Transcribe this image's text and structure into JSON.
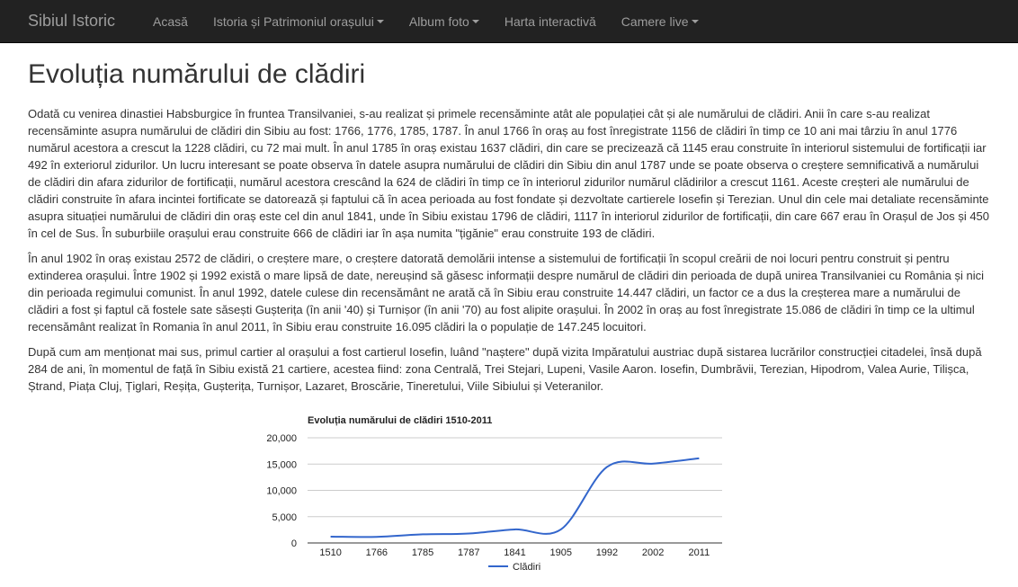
{
  "navbar": {
    "brand": "Sibiul Istoric",
    "items": [
      {
        "label": "Acasă",
        "dropdown": false
      },
      {
        "label": "Istoria și Patrimoniul orașului",
        "dropdown": true
      },
      {
        "label": "Album foto",
        "dropdown": true
      },
      {
        "label": "Harta interactivă",
        "dropdown": false
      },
      {
        "label": "Camere live",
        "dropdown": true
      }
    ]
  },
  "page": {
    "title": "Evoluția numărului de clădiri",
    "paragraphs": [
      "Odată cu venirea dinastiei Habsburgice în fruntea Transilvaniei, s-au realizat și primele recensăminte atât ale populației cât și ale numărului de clădiri. Anii în care s-au realizat recensăminte asupra numărului de clădiri din Sibiu au fost: 1766, 1776, 1785, 1787. În anul 1766 în oraș au fost înregistrate 1156 de clădiri în timp ce 10 ani mai târziu în anul 1776 numărul acestora a crescut la 1228 clădiri, cu 72 mai mult. În anul 1785 în oraș existau 1637 clădiri, din care se precizează că 1145 erau construite în interiorul sistemului de fortificații iar 492 în exteriorul zidurilor. Un lucru interesant se poate observa în datele asupra numărului de clădiri din Sibiu din anul 1787 unde se poate observa o creștere semnificativă a numărului de clădiri din afara zidurilor de fortificații, numărul acestora crescând la 624 de clădiri în timp ce în interiorul zidurilor numărul clădirilor a crescut 1161. Aceste creșteri ale numărului de clădiri construite în afara incintei fortificate se datorează și faptului că în acea perioada au fost fondate și dezvoltate cartierele Iosefin și Terezian. Unul din cele mai detaliate recensăminte asupra situației numărului de clădiri din oraș este cel din anul 1841, unde în Sibiu existau 1796 de clădiri, 1117 în interiorul zidurilor de fortificații, din care 667 erau în Orașul de Jos și 450 în cel de Sus. În suburbiile orașului erau construite 666 de clădiri iar în așa numita \"țigănie\" erau construite 193 de clădiri.",
      "În anul 1902 în oraș existau 2572 de clădiri, o creștere mare, o creștere datorată demolării intense a sistemului de fortificații în scopul creării de noi locuri pentru construit și pentru extinderea orașului. Între 1902 și 1992 există o mare lipsă de date, nereușind să găsesc informații despre numărul de clădiri din perioada de după unirea Transilvaniei cu România și nici din perioada regimului comunist. În anul 1992, datele culese din recensământ ne arată că în Sibiu erau construite 14.447 clădiri, un factor ce a dus la creșterea mare a numărului de clădiri a fost și faptul că fostele sate săsești Gușterița (în anii '40) și Turnișor (în anii '70) au fost alipite orașului. În 2002 în oraș au fost înregistrate 15.086 de clădiri în timp ce la ultimul recensământ realizat în Romania în anul 2011, în Sibiu erau construite 16.095 clădiri la o populație de 147.245 locuitori.",
      "După cum am menționat mai sus, primul cartier al orașului a fost cartierul Iosefin, luând \"naștere\" după vizita Impăratului austriac după sistarea lucrărilor construcției citadelei, însă după 284 de ani, în momentul de față în Sibiu există 21 cartiere, acestea fiind: zona Centrală, Trei Stejari, Lupeni, Vasile Aaron. Iosefin, Dumbrăvii, Terezian, Hipodrom, Valea Aurie, Tilișca, Ștrand, Piața Cluj, Țiglari, Reșița, Gușterița, Turnișor, Lazaret, Broscărie, Tineretului, Viile Sibiului și Veteranilor."
    ]
  },
  "chart_data": {
    "type": "line",
    "title": "Evoluția numărului de clădiri 1510-2011",
    "categories": [
      "1510",
      "1766",
      "1785",
      "1787",
      "1841",
      "1905",
      "1992",
      "2002",
      "2011"
    ],
    "series": [
      {
        "name": "Clădiri",
        "values": [
          1200,
          1156,
          1637,
          1785,
          2572,
          2572,
          14447,
          15086,
          16095
        ],
        "color": "#3366cc"
      }
    ],
    "yticks": [
      "0",
      "5,000",
      "10,000",
      "15,000",
      "20,000"
    ],
    "ylim": [
      0,
      20000
    ],
    "grid": true,
    "legend": "bottom"
  }
}
